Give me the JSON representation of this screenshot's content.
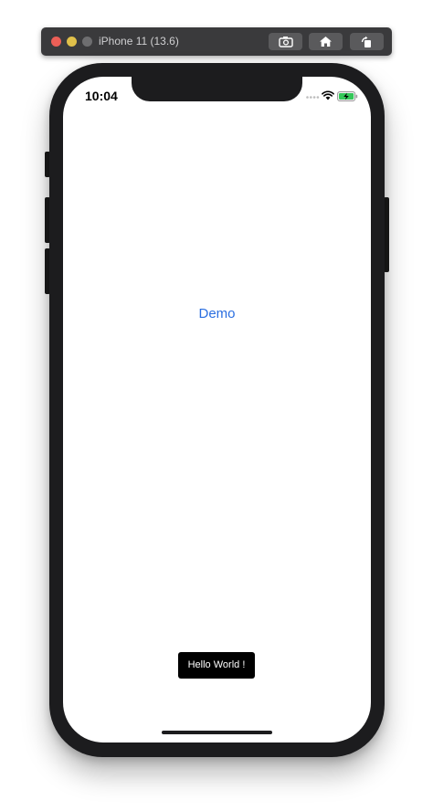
{
  "window": {
    "title": "iPhone 11 (13.6)",
    "icons": [
      "screenshot-icon",
      "home-icon",
      "rotate-icon"
    ]
  },
  "status_bar": {
    "time": "10:04",
    "icons": [
      "signal-icon",
      "wifi-icon",
      "battery-charging-icon"
    ],
    "battery_color": "#34c759"
  },
  "app": {
    "link_label": "Demo",
    "link_color": "#2a6ee0",
    "toast_label": "Hello World !"
  }
}
